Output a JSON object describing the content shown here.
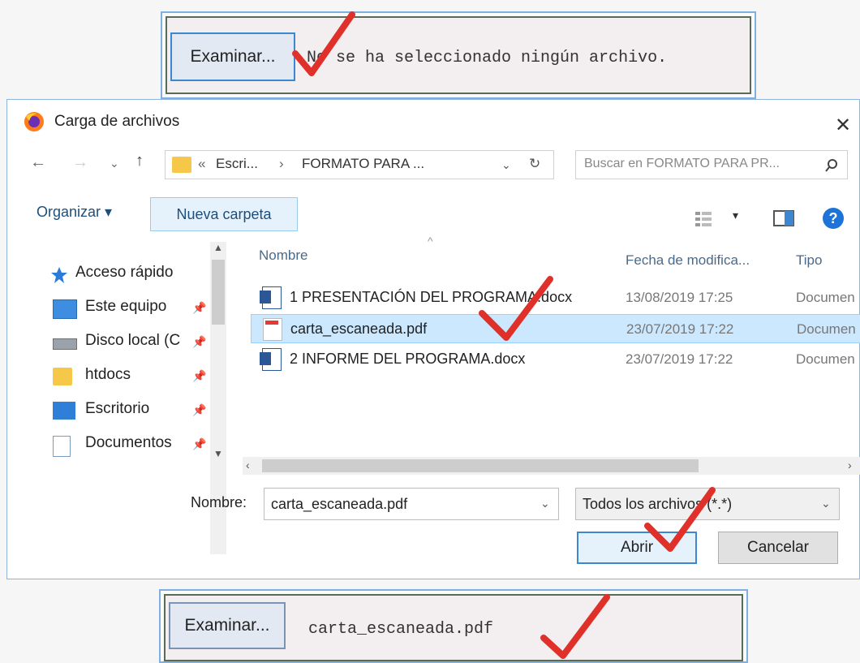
{
  "top_input": {
    "button_label": "Examinar...",
    "status_text": "No se ha seleccionado ningún archivo."
  },
  "dialog": {
    "title": "Carga de archivos",
    "address": {
      "prefix": "«",
      "crumb1": "Escri...",
      "separator": "›",
      "crumb2": "FORMATO PARA ..."
    },
    "search_placeholder": "Buscar en FORMATO PARA PR...",
    "toolbar": {
      "organize": "Organizar ▾",
      "new_folder": "Nueva carpeta"
    },
    "sidebar": {
      "items": [
        {
          "label": "Acceso rápido",
          "icon": "star-icon"
        },
        {
          "label": "Este equipo",
          "icon": "computer-icon"
        },
        {
          "label": "Disco local (C",
          "icon": "drive-icon"
        },
        {
          "label": "htdocs",
          "icon": "folder-icon"
        },
        {
          "label": "Escritorio",
          "icon": "desktop-icon"
        },
        {
          "label": "Documentos",
          "icon": "documents-icon"
        }
      ]
    },
    "columns": {
      "name": "Nombre",
      "date": "Fecha de modifica...",
      "type": "Tipo"
    },
    "files": [
      {
        "name": "1 PRESENTACIÓN DEL PROGRAMA.docx",
        "date": "13/08/2019 17:25",
        "type": "Documen",
        "icon": "word-icon"
      },
      {
        "name": "carta_escaneada.pdf",
        "date": "23/07/2019 17:22",
        "type": "Documen",
        "icon": "pdf-icon",
        "selected": true
      },
      {
        "name": "2 INFORME DEL PROGRAMA.docx",
        "date": "23/07/2019 17:22",
        "type": "Documen",
        "icon": "word-icon"
      }
    ],
    "filename_label": "Nombre:",
    "filename_value": "carta_escaneada.pdf",
    "filter_value": "Todos los archivos (*.*)",
    "open_label": "Abrir",
    "cancel_label": "Cancelar"
  },
  "bottom_input": {
    "button_label": "Examinar...",
    "file_text": "carta_escaneada.pdf"
  },
  "colors": {
    "check_red": "#e0302a",
    "selected_row": "#cce8ff",
    "accent_blue": "#3d87d0"
  }
}
